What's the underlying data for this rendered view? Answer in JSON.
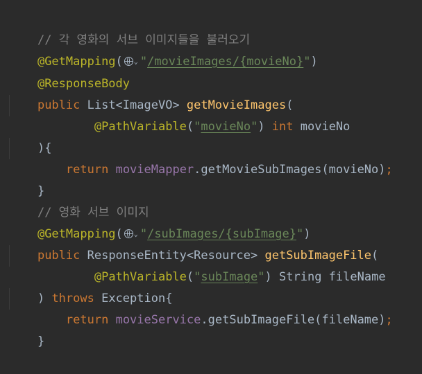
{
  "code": {
    "l1_comment": "// 각 영화의 서브 이미지들을 불러오기",
    "l2_annot": "@GetMapping",
    "l2_open": "(",
    "l2_quote_open": "\"",
    "l2_path": "/movieImages/{movieNo}",
    "l2_quote_close": "\"",
    "l2_close": ")",
    "l3_annot": "@ResponseBody",
    "l4_kw": "public",
    "l4_type": " List<ImageVO> ",
    "l4_method": "getMovieImages",
    "l4_paren": "(",
    "l5_indent": "        ",
    "l5_annot": "@PathVariable",
    "l5_open": "(",
    "l5_q1": "\"",
    "l5_str": "movieNo",
    "l5_q2": "\"",
    "l5_close": ") ",
    "l5_kw": "int",
    "l5_param": " movieNo",
    "l6_text": "){",
    "l7_indent": "    ",
    "l7_kw": "return",
    "l7_sp": " ",
    "l7_field": "movieMapper",
    "l7_call": ".getMovieSubImages(movieNo)",
    "l7_semi": ";",
    "l8_text": "}",
    "l9_comment": "// 영화 서브 이미지",
    "l10_annot": "@GetMapping",
    "l10_open": "(",
    "l10_quote_open": "\"",
    "l10_path": "/subImages/{subImage}",
    "l10_quote_close": "\"",
    "l10_close": ")",
    "l11_kw": "public",
    "l11_type": " ResponseEntity<Resource> ",
    "l11_method": "getSubImageFile",
    "l11_paren": "(",
    "l12_indent": "        ",
    "l12_annot": "@PathVariable",
    "l12_open": "(",
    "l12_q1": "\"",
    "l12_str": "subImage",
    "l12_q2": "\"",
    "l12_close": ")",
    "l12_param": " String fileName",
    "l13_open": ") ",
    "l13_kw": "throws",
    "l13_exc": " Exception{",
    "l14_indent": "    ",
    "l14_kw": "return",
    "l14_sp": " ",
    "l14_field": "movieService",
    "l14_call": ".getSubImageFile(fileName)",
    "l14_semi": ";",
    "l15_text": "}",
    "chev_glyph": "⌄"
  },
  "icons": {
    "url_inlay": "globe-icon",
    "url_dropdown": "chevron-down-icon"
  },
  "colors": {
    "background": "#2b2b2b",
    "comment": "#808080",
    "annotation": "#bbb529",
    "keyword": "#cc7832",
    "method": "#ffc66d",
    "field": "#9876aa",
    "string": "#6a8759",
    "text": "#a9b7c6"
  }
}
